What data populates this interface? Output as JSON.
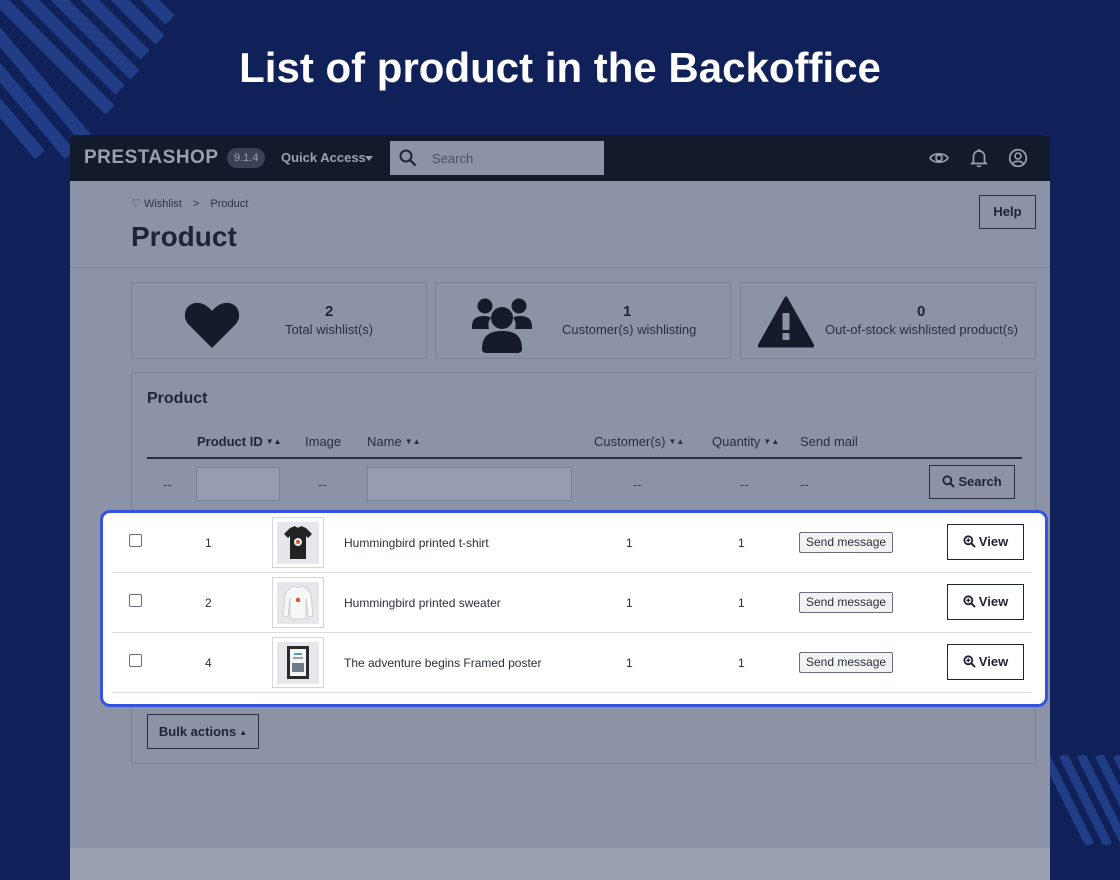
{
  "hero": {
    "title": "List of product in the Backoffice"
  },
  "topbar": {
    "logo": "PRESTASHOP",
    "version": "9.1.4",
    "quick_access": "Quick Access",
    "search_placeholder": "Search"
  },
  "breadcrumb": {
    "parent": "Wishlist",
    "separator": ">",
    "current": "Product"
  },
  "page": {
    "title": "Product",
    "help_label": "Help"
  },
  "kpis": [
    {
      "value": "2",
      "label": "Total wishlist(s)",
      "icon": "heart-icon"
    },
    {
      "value": "1",
      "label": "Customer(s) wishlisting",
      "icon": "users-icon"
    },
    {
      "value": "0",
      "label": "Out-of-stock wishlisted product(s)",
      "icon": "warning-icon"
    }
  ],
  "panel": {
    "title": "Product",
    "columns": [
      "Product ID",
      "Image",
      "Name",
      "Customer(s)",
      "Quantity",
      "Send mail"
    ],
    "filter_placeholder": "--",
    "search_label": "Search",
    "bulk_label": "Bulk actions"
  },
  "rows": [
    {
      "id": "1",
      "name": "Hummingbird printed t-shirt",
      "customers": "1",
      "quantity": "1",
      "send_label": "Send message",
      "view_label": "View",
      "image": "tshirt"
    },
    {
      "id": "2",
      "name": "Hummingbird printed sweater",
      "customers": "1",
      "quantity": "1",
      "send_label": "Send message",
      "view_label": "View",
      "image": "sweater"
    },
    {
      "id": "4",
      "name": "The adventure begins Framed poster",
      "customers": "1",
      "quantity": "1",
      "send_label": "Send message",
      "view_label": "View",
      "image": "poster"
    }
  ],
  "colors": {
    "background": "#0f2158",
    "highlight_border": "#3553e0",
    "topbar": "#131a2c"
  }
}
